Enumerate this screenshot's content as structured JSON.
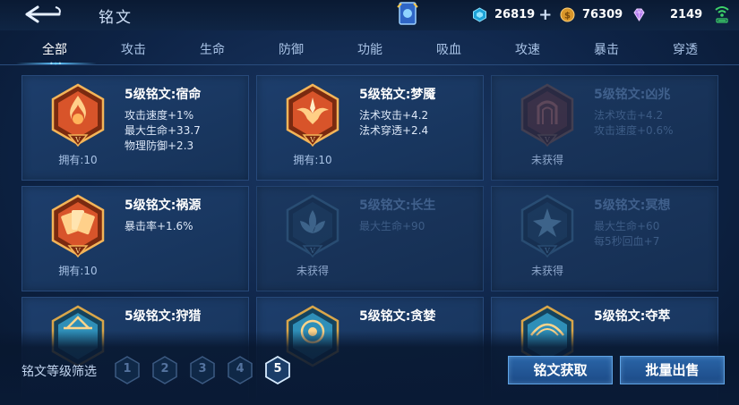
{
  "header": {
    "title": "铭文",
    "resources": {
      "coupons": "26819",
      "gold": "76309",
      "diamonds": "2149"
    }
  },
  "tabs": [
    "全部",
    "攻击",
    "生命",
    "防御",
    "功能",
    "吸血",
    "攻速",
    "暴击",
    "穿透"
  ],
  "cards": [
    {
      "name": "5级铭文:宿命",
      "attrs": [
        "攻击速度+1%",
        "最大生命+33.7",
        "物理防御+2.3"
      ],
      "status": "拥有:10",
      "locked": false,
      "icon": "flame-v-emblem-icon",
      "color": "#d8542a"
    },
    {
      "name": "5级铭文:梦魇",
      "attrs": [
        "法术攻击+4.2",
        "法术穿透+2.4"
      ],
      "status": "拥有:10",
      "locked": false,
      "icon": "wing-flame-emblem-icon",
      "color": "#d8542a"
    },
    {
      "name": "5级铭文:凶兆",
      "attrs": [
        "法术攻击+4.2",
        "攻击速度+0.6%"
      ],
      "status": "未获得",
      "locked": true,
      "icon": "gate-emblem-icon",
      "color": "#6b3a3a"
    },
    {
      "name": "5级铭文:祸源",
      "attrs": [
        "暴击率+1.6%"
      ],
      "status": "拥有:10",
      "locked": false,
      "icon": "cards-emblem-icon",
      "color": "#d8542a"
    },
    {
      "name": "5级铭文:长生",
      "attrs": [
        "最大生命+90"
      ],
      "status": "未获得",
      "locked": true,
      "icon": "lotus-emblem-icon",
      "color": "#2a5276"
    },
    {
      "name": "5级铭文:冥想",
      "attrs": [
        "最大生命+60",
        "每5秒回血+7"
      ],
      "status": "未获得",
      "locked": true,
      "icon": "star-emblem-icon",
      "color": "#2a5276"
    },
    {
      "name": "5级铭文:狩猎",
      "attrs": [],
      "status": "",
      "locked": false,
      "icon": "hunt-emblem-icon",
      "color": "#2f8fb8"
    },
    {
      "name": "5级铭文:贪婪",
      "attrs": [],
      "status": "",
      "locked": false,
      "icon": "greed-emblem-icon",
      "color": "#2f8fb8"
    },
    {
      "name": "5级铭文:夺萃",
      "attrs": [],
      "status": "",
      "locked": false,
      "icon": "seize-emblem-icon",
      "color": "#2f8fb8"
    }
  ],
  "filter": {
    "label": "铭文等级筛选",
    "levels": [
      "1",
      "2",
      "3",
      "4",
      "5"
    ],
    "selected": "5"
  },
  "buttons": {
    "obtain": "铭文获取",
    "bulk_sell": "批量出售"
  }
}
